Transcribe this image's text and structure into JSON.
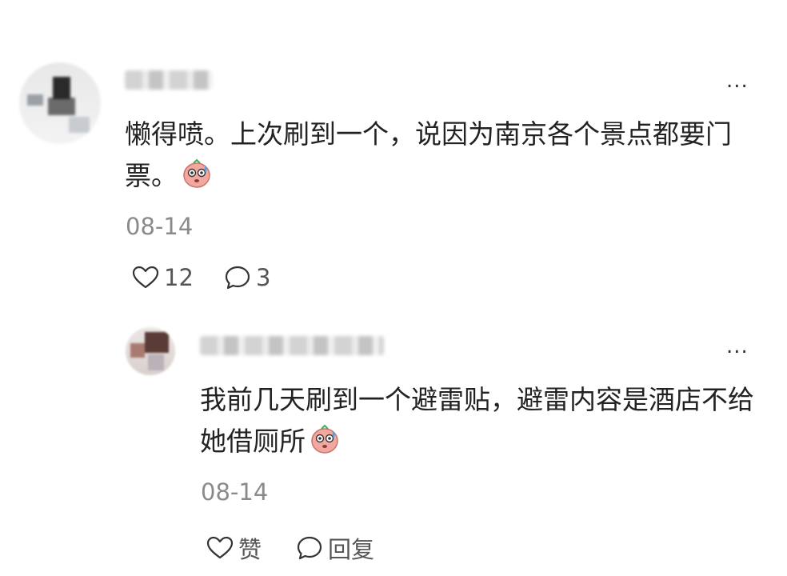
{
  "comments": [
    {
      "text": "懒得喷。上次刷到一个，说因为南京各个景点都要门票。",
      "emoji": "sweat-face-emoji",
      "date": "08-14",
      "likes": "12",
      "replies": "3",
      "more": "..."
    },
    {
      "text": "我前几天刷到一个避雷贴，避雷内容是酒店不给她借厕所",
      "emoji": "sweat-face-emoji",
      "date": "08-14",
      "like_label": "赞",
      "reply_label": "回复",
      "more": "..."
    }
  ],
  "icons": {
    "like": "heart-outline-icon",
    "reply": "speech-bubble-icon",
    "more": "more-dots-icon"
  }
}
